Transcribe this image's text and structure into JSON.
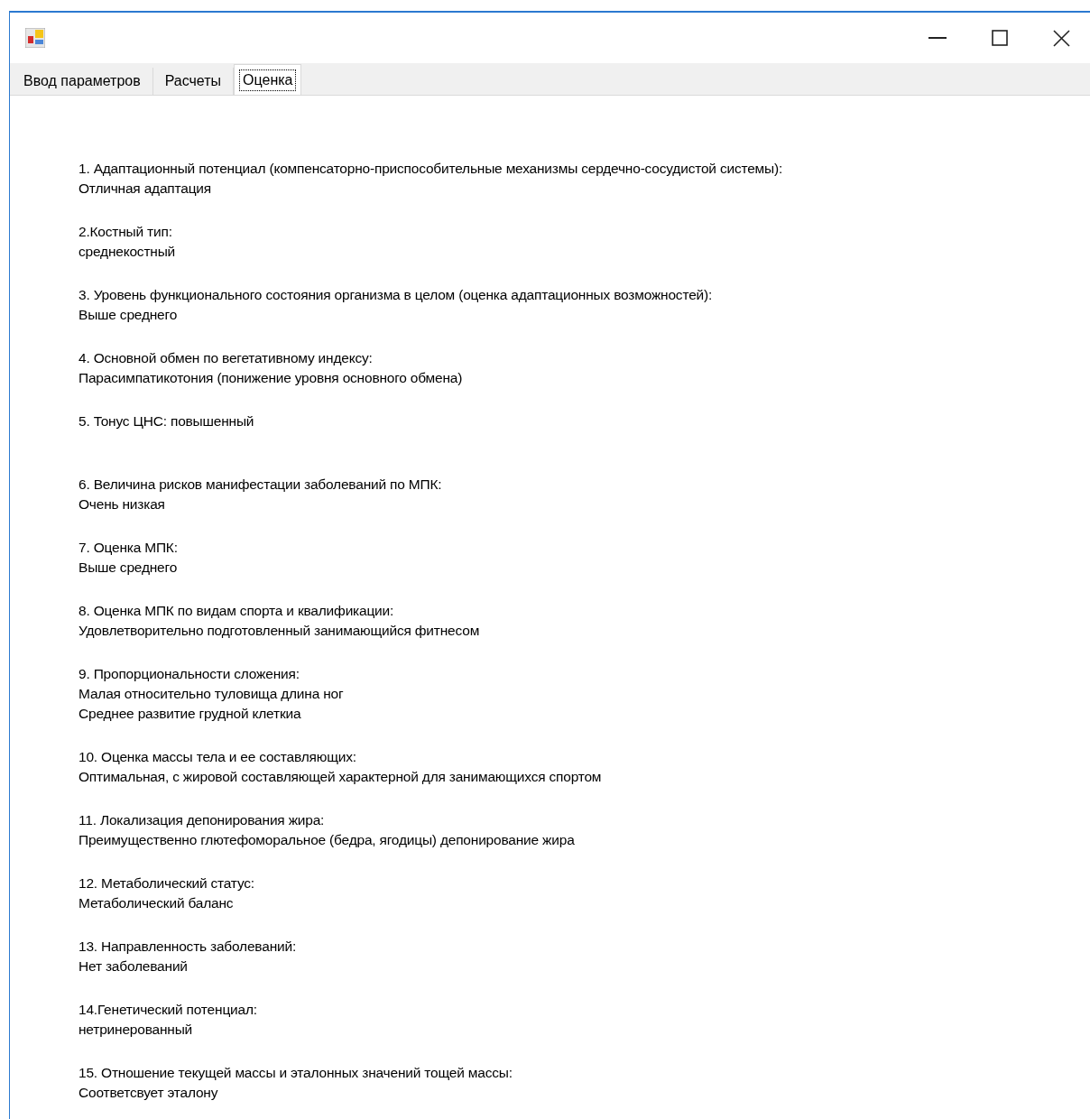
{
  "tabs": [
    {
      "label": "Ввод параметров",
      "selected": false
    },
    {
      "label": "Расчеты",
      "selected": false
    },
    {
      "label": "Оценка",
      "selected": true
    }
  ],
  "results": [
    {
      "title": "1. Адаптационный потенциал (компенсаторно-приспособительные механизмы сердечно-сосудистой системы):",
      "lines": [
        "Отличная адаптация"
      ]
    },
    {
      "title": "2.Костный тип:",
      "lines": [
        "среднекостный"
      ]
    },
    {
      "title": "3. Уровень функционального состояния организма в целом (оценка адаптационных возможностей):",
      "lines": [
        "Выше среднего"
      ]
    },
    {
      "title": "4. Основной обмен по вегетативному индексу:",
      "lines": [
        "Парасимпатикотония (понижение уровня основного обмена)"
      ]
    },
    {
      "title": "5. Тонус ЦНС: повышенный"
    },
    {
      "title": "6. Величина рисков манифестации заболеваний по МПК:",
      "lines": [
        "Очень низкая"
      ]
    },
    {
      "title": "7. Оценка МПК:",
      "lines": [
        "Выше среднего"
      ]
    },
    {
      "title": "8. Оценка МПК  по видам спорта и  квалификации:",
      "lines": [
        "Удовлетворительно подготовленный занимающийся фитнесом"
      ]
    },
    {
      "title": "9. Пропорциональности сложения:",
      "lines": [
        "Малая относительно туловища длина ног",
        "Среднее развитие грудной клеткиа"
      ]
    },
    {
      "title": "10. Оценка массы тела и ее составляющих:",
      "lines": [
        "Оптимальная, с жировой составляющей характерной для занимающихся спортом"
      ]
    },
    {
      "title": "11. Локализация депонирования жира:",
      "lines": [
        "Преимущественно глютефоморальное (бедра, ягодицы) депонирование жира"
      ]
    },
    {
      "title": "12. Метаболический статус:",
      "lines": [
        "Метаболический баланс"
      ]
    },
    {
      "title": "13. Направленность заболеваний:",
      "lines": [
        "Нет заболеваний"
      ]
    },
    {
      "title": "14.Генетический потенциал:",
      "lines": [
        "нетринерованный"
      ]
    },
    {
      "title": "15. Отношение текущей массы и эталонных значений тощей массы:",
      "lines": [
        "Соответсвует эталону"
      ]
    }
  ]
}
